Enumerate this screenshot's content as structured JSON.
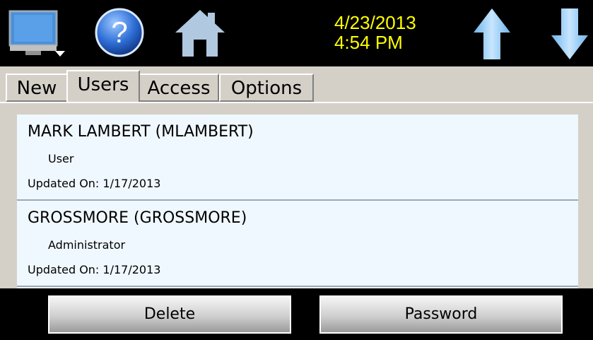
{
  "header": {
    "date": "4/23/2013",
    "time": "4:54 PM"
  },
  "icons": {
    "monitor": "monitor-icon",
    "help": "help-icon",
    "home": "home-icon",
    "up": "arrow-up-icon",
    "down": "arrow-down-icon"
  },
  "tabs": [
    {
      "label": "New"
    },
    {
      "label": "Users",
      "active": true
    },
    {
      "label": "Access"
    },
    {
      "label": "Options"
    }
  ],
  "users": [
    {
      "name": "MARK LAMBERT (MLAMBERT)",
      "role": "User",
      "updated": "Updated On:  1/17/2013"
    },
    {
      "name": "GROSSMORE (GROSSMORE)",
      "role": "Administrator",
      "updated": "Updated On:  1/17/2013"
    }
  ],
  "buttons": {
    "delete": "Delete",
    "password": "Password"
  },
  "colors": {
    "datetime": "#ffff00",
    "arrow": "#8ec8f0",
    "home": "#b0c8e0"
  }
}
